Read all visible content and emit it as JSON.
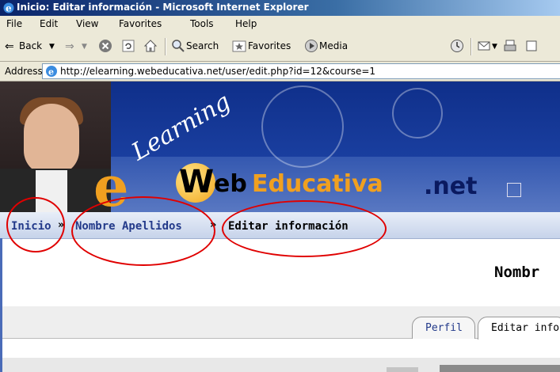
{
  "window": {
    "title": "Inicio: Editar información - Microsoft Internet Explorer"
  },
  "menu": [
    "File",
    "Edit",
    "View",
    "Favorites",
    "Tools",
    "Help"
  ],
  "toolbar": {
    "back_label": "Back",
    "search_label": "Search",
    "favorites_label": "Favorites",
    "media_label": "Media"
  },
  "address": {
    "label": "Address",
    "url": "http://elearning.webeducativa.net/user/edit.php?id=12&course=1"
  },
  "banner": {
    "e_letter": "e",
    "learning_text": "Learning",
    "w_letter": "W",
    "eb_text": "eb",
    "educativa_text": "Educativa",
    "net_text": ".net"
  },
  "breadcrumb": {
    "home": "Inicio",
    "user": "Nombre Apellidos",
    "current": "Editar información",
    "separator": "»"
  },
  "page": {
    "heading": "Nombr"
  },
  "tabs": [
    {
      "label": "Perfil"
    },
    {
      "label": "Editar infor"
    }
  ],
  "colors": {
    "annotation": "#e00000",
    "breadcrumb_link": "#233a8a",
    "brand_orange": "#f0a020"
  }
}
